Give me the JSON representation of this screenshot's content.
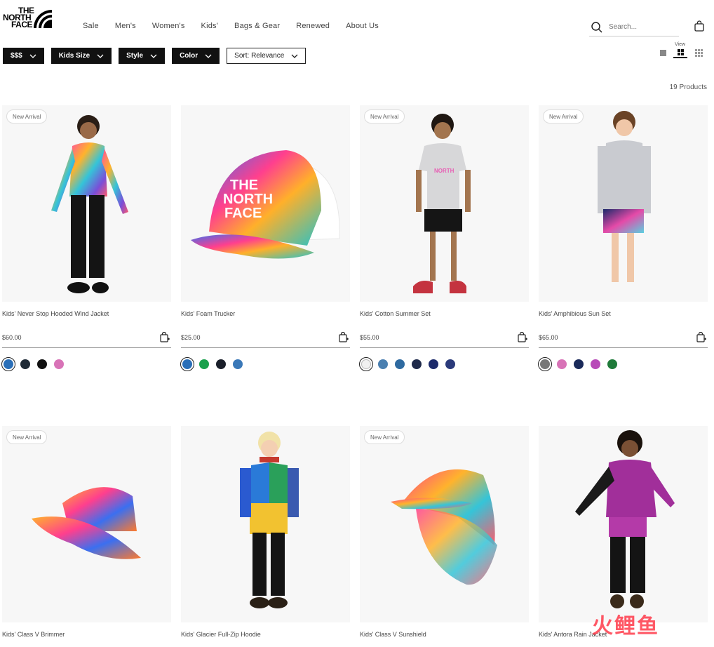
{
  "brand": {
    "logo_lines": [
      "THE",
      "NORTH",
      "FACE"
    ]
  },
  "nav": [
    "Sale",
    "Men's",
    "Women's",
    "Kids'",
    "Bags & Gear",
    "Renewed",
    "About Us"
  ],
  "search": {
    "placeholder": "Search..."
  },
  "filters": [
    "$$$",
    "Kids Size",
    "Style",
    "Color"
  ],
  "sort": {
    "label": "Sort: Relevance"
  },
  "view": {
    "label": "View"
  },
  "results": {
    "count": "19 Products"
  },
  "products": [
    {
      "badge": "New Arrival",
      "name": "Kids' Never Stop Hooded Wind Jacket",
      "price": "$60.00",
      "swatches": [
        "#2a6fb8",
        "#1f2a36",
        "#111111",
        "#d873b7"
      ],
      "selected": 0
    },
    {
      "badge": "New Arrival",
      "name": "Kids' Foam Trucker",
      "price": "$25.00",
      "swatches": [
        "#2a6fb8",
        "#1aa04c",
        "#1a1f2a",
        "#3a78b8"
      ],
      "selected": 0
    },
    {
      "badge": "New Arrival",
      "name": "Kids' Cotton Summer Set",
      "price": "$55.00",
      "swatches": [
        "#f1f1f1",
        "#4a7fb0",
        "#2e6aa0",
        "#1f2a4a",
        "#1c2a6a",
        "#2a3a7a"
      ],
      "selected": 0
    },
    {
      "badge": "New Arrival",
      "name": "Kids' Amphibious Sun Set",
      "price": "$65.00",
      "swatches": [
        "#777777",
        "#d873b7",
        "#1a2a5a",
        "#b84ab8",
        "#1f7a3a"
      ],
      "selected": 0
    },
    {
      "badge": "New Arrival",
      "name": "Kids' Class V Brimmer",
      "price": "",
      "swatches": [],
      "selected": -1
    },
    {
      "badge": "",
      "name": "Kids' Glacier Full-Zip Hoodie",
      "price": "",
      "swatches": [],
      "selected": -1
    },
    {
      "badge": "New Arrival",
      "name": "Kids' Class V Sunshield",
      "price": "",
      "swatches": [],
      "selected": -1
    },
    {
      "badge": "",
      "name": "Kids' Antora Rain Jacket",
      "price": "",
      "swatches": [],
      "selected": -1
    }
  ],
  "watermark": "火鲤鱼"
}
